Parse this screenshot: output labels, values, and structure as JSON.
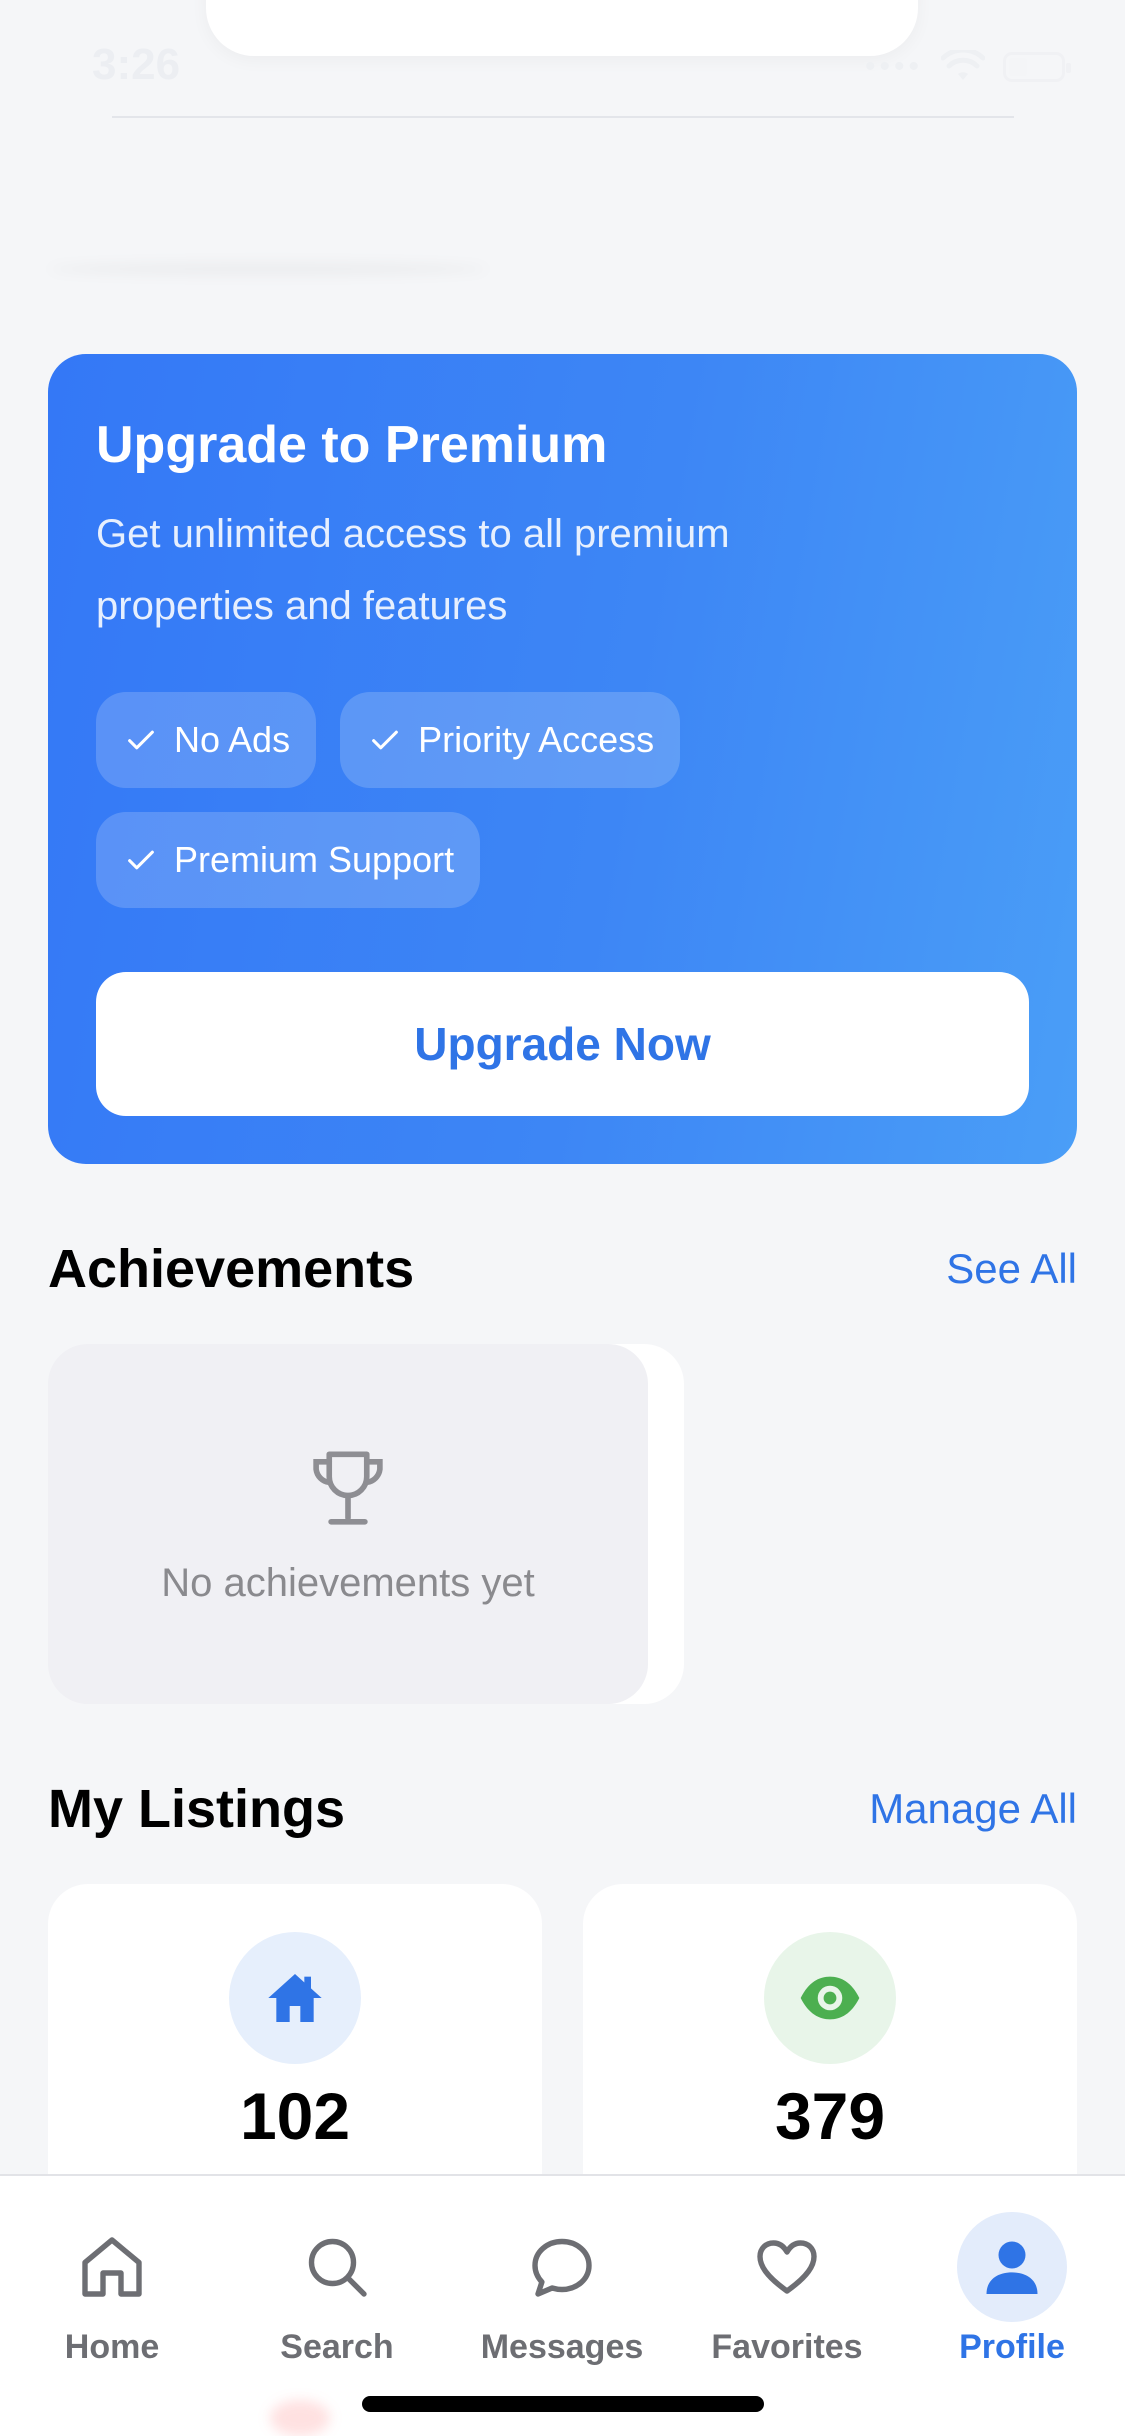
{
  "status_bar": {
    "time": "3:26"
  },
  "premium": {
    "title": "Upgrade to Premium",
    "description": "Get unlimited access to all premium properties and features",
    "features": [
      "No Ads",
      "Priority Access",
      "Premium Support"
    ],
    "button_label": "Upgrade Now"
  },
  "achievements": {
    "title": "Achievements",
    "link": "See All",
    "empty_text": "No achievements yet"
  },
  "listings": {
    "title": "My Listings",
    "link": "Manage All",
    "stats": [
      {
        "icon": "house-icon",
        "value": "102",
        "color": "#2f74e6",
        "bg": "#e6effc"
      },
      {
        "icon": "eye-icon",
        "value": "379",
        "color": "#4caf50",
        "bg": "#e8f5e9"
      }
    ]
  },
  "tab_bar": {
    "items": [
      {
        "label": "Home",
        "icon": "home-icon",
        "active": false
      },
      {
        "label": "Search",
        "icon": "search-icon",
        "active": false
      },
      {
        "label": "Messages",
        "icon": "chat-bubble-icon",
        "active": false
      },
      {
        "label": "Favorites",
        "icon": "heart-icon",
        "active": false
      },
      {
        "label": "Profile",
        "icon": "person-icon",
        "active": true
      }
    ]
  },
  "colors": {
    "accent": "#2f74e6",
    "background": "#f5f6f8"
  }
}
